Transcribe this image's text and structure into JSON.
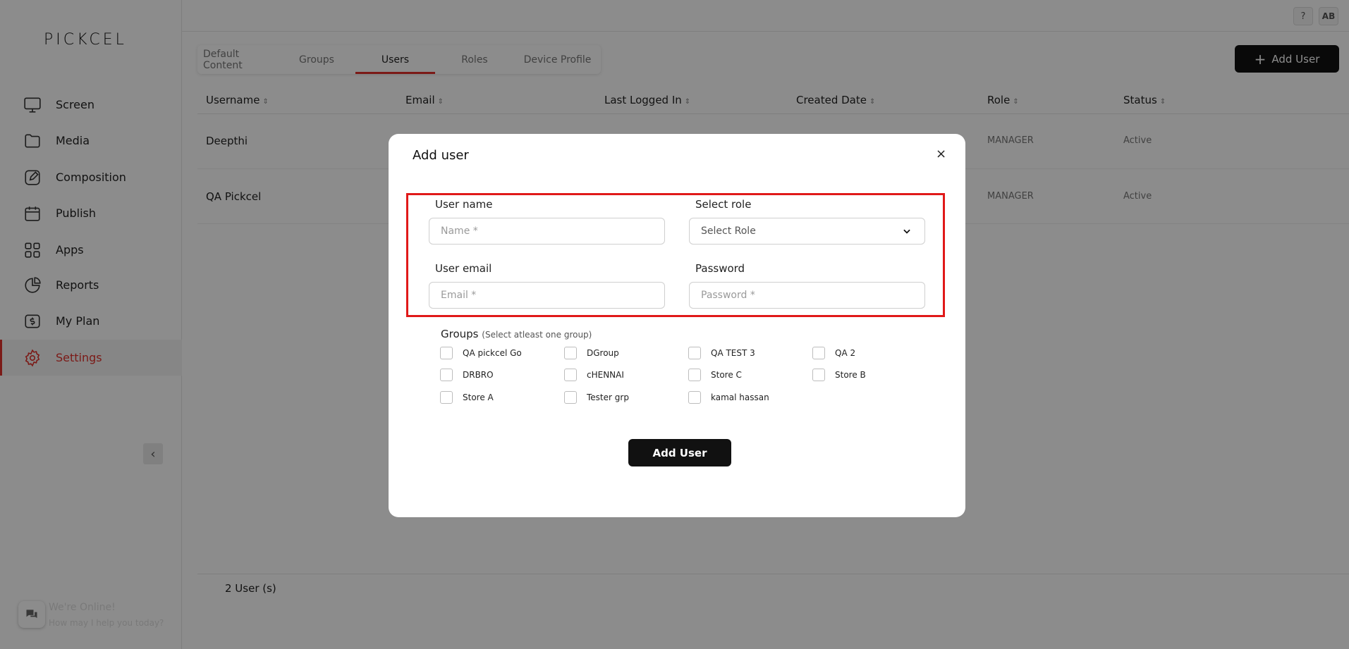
{
  "app": {
    "logo": "PICKCEL"
  },
  "sidebar": {
    "items": [
      {
        "label": "Screen",
        "icon": "monitor-icon"
      },
      {
        "label": "Media",
        "icon": "folder-icon"
      },
      {
        "label": "Composition",
        "icon": "edit-icon"
      },
      {
        "label": "Publish",
        "icon": "calendar-icon"
      },
      {
        "label": "Apps",
        "icon": "grid-icon"
      },
      {
        "label": "Reports",
        "icon": "pie-chart-icon"
      },
      {
        "label": "My Plan",
        "icon": "dollar-icon"
      },
      {
        "label": "Settings",
        "icon": "gear-icon",
        "active": true
      }
    ],
    "chat_title": "We're Online!",
    "chat_subtitle": "How may I help you today?"
  },
  "topbar": {
    "help": "?",
    "avatar": "AB"
  },
  "tabs": [
    {
      "label": "Default Content"
    },
    {
      "label": "Groups"
    },
    {
      "label": "Users",
      "active": true
    },
    {
      "label": "Roles"
    },
    {
      "label": "Device Profile"
    }
  ],
  "header_button": {
    "label": "Add User"
  },
  "table": {
    "columns": [
      "Username",
      "Email",
      "Last Logged In",
      "Created Date",
      "Role",
      "Status"
    ],
    "rows": [
      {
        "username": "Deepthi",
        "role": "MANAGER",
        "status": "Active"
      },
      {
        "username": "QA Pickcel",
        "role": "MANAGER",
        "status": "Active"
      }
    ],
    "footer_count": "2 User (s)"
  },
  "modal": {
    "title": "Add user",
    "close": "×",
    "username_label": "User name",
    "username_placeholder": "Name *",
    "role_label": "Select role",
    "role_placeholder": "Select Role",
    "email_label": "User email",
    "email_placeholder": "Email *",
    "password_label": "Password",
    "password_placeholder": "Password *",
    "groups_label": "Groups",
    "groups_hint": "(Select atleast one group)",
    "groups": [
      "QA pickcel Go",
      "DGroup",
      "QA TEST 3",
      "QA 2",
      "DRBRO",
      "cHENNAI",
      "Store C",
      "Store B",
      "Store A",
      "Tester grp",
      "kamal hassan"
    ],
    "submit_label": "Add User"
  },
  "colors": {
    "accent": "#e0312b",
    "highlight": "#e01919",
    "button": "#111111"
  }
}
